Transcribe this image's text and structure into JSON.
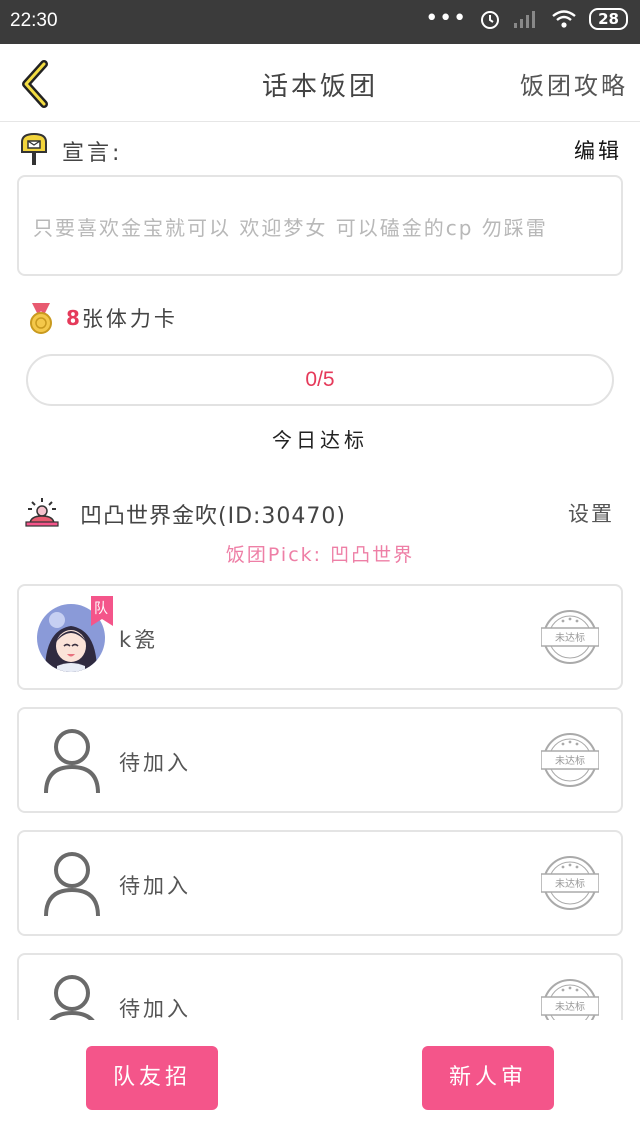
{
  "status_bar": {
    "time": "22:30",
    "battery": "28"
  },
  "nav": {
    "title": "话本饭团",
    "right_link": "饭团攻略",
    "back_icon": "chevron-left-icon"
  },
  "declaration": {
    "label": "宣言:",
    "edit_label": "编辑",
    "text": "只要喜欢金宝就可以 欢迎梦女 可以磕金的cp 勿踩雷"
  },
  "stamina": {
    "count": "8",
    "label": "张体力卡"
  },
  "progress": {
    "text": "0/5",
    "current": 0,
    "total": 5
  },
  "daily_status": "今日达标",
  "team": {
    "name": "凹凸世界金吹(ID:30470)",
    "settings_label": "设置",
    "pick": "饭团Pick: 凹凸世界"
  },
  "members": [
    {
      "name": "k瓷",
      "tag": "队",
      "stamp": "未达标",
      "has_avatar": true
    },
    {
      "name": "待加入",
      "stamp": "未达标",
      "has_avatar": false
    },
    {
      "name": "待加入",
      "stamp": "未达标",
      "has_avatar": false
    },
    {
      "name": "待加入",
      "stamp": "未达标",
      "has_avatar": false
    }
  ],
  "buttons": {
    "recruit": "队友招募",
    "approve": "新人审批"
  },
  "colors": {
    "accent": "#f4558a",
    "pick": "#ee7fa6",
    "progress_text": "#e53a5a"
  }
}
